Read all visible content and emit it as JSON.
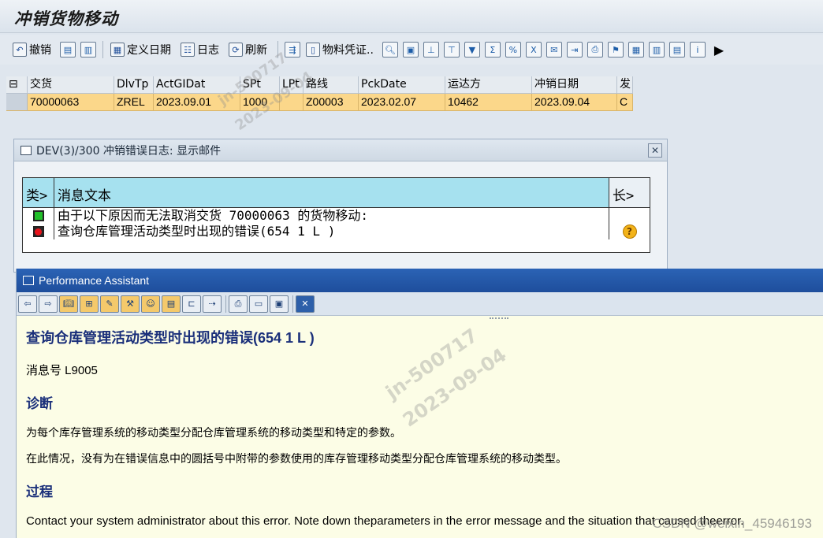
{
  "window": {
    "title": "冲销货物移动"
  },
  "toolbar": {
    "undo_label": "撤销",
    "define_date_label": "定义日期",
    "log_label": "日志",
    "refresh_label": "刷新",
    "material_doc_label": "物料凭证.."
  },
  "grid": {
    "columns": [
      "交货",
      "DlvTp",
      "ActGIDat",
      "SPt",
      "LPt",
      "路线",
      "PckDate",
      "运达方",
      "冲销日期",
      "发"
    ],
    "rows": [
      {
        "delivery": "70000063",
        "dlvtp": "ZREL",
        "actgidat": "2023.09.01",
        "spt": "1000",
        "lpt": "",
        "route": "Z00003",
        "pckdate": "2023.02.07",
        "shipto": "10462",
        "revdate": "2023.09.04",
        "status": "C"
      }
    ]
  },
  "dialog": {
    "title": "DEV(3)/300 冲销错误日志: 显示邮件",
    "col_type": "类>",
    "col_text": "消息文本",
    "col_long": "长>",
    "messages": [
      {
        "type": "success",
        "text": "由于以下原因而无法取消交货 70000063 的货物移动:"
      },
      {
        "type": "error",
        "text": "查询仓库管理活动类型时出现的错误(654 1 L   )"
      }
    ]
  },
  "performance_assistant": {
    "title": "Performance Assistant",
    "heading": "查询仓库管理活动类型时出现的错误(654 1 L   )",
    "message_no": "消息号 L9005",
    "diagnosis_heading": "诊断",
    "diagnosis_text": "为每个库存管理系统的移动类型分配仓库管理系统的移动类型和特定的参数。",
    "diagnosis_text2": "在此情况，没有为在错误信息中的圆括号中附带的参数使用的库存管理移动类型分配仓库管理系统的移动类型。",
    "procedure_heading": "过程",
    "procedure_text": "Contact your system administrator about this error.  Note down theparameters in the error message and the situation that caused theerror."
  },
  "watermark": {
    "line1": "jn-500717",
    "line2": "2023-09-04",
    "csdn": "CSDN @weixin_45946193"
  }
}
